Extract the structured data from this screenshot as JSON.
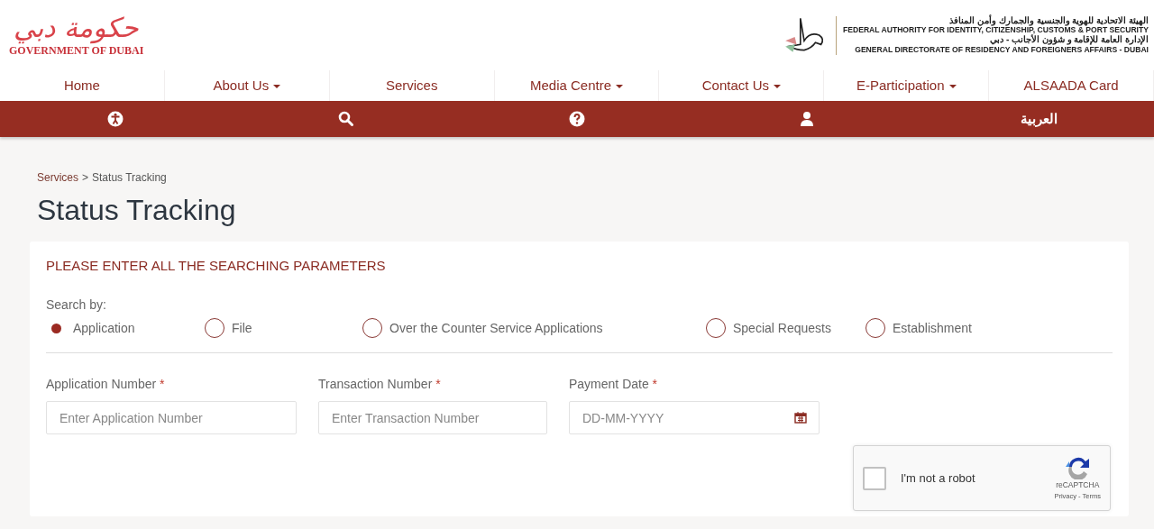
{
  "header": {
    "logo_arabic": "حكومة دبي",
    "logo_english": "GOVERNMENT OF DUBAI",
    "authority_lines": [
      "الهيئة الاتحادية للهوية والجنسية والجمارك وأمن المنافذ",
      "FEDERAL AUTHORITY FOR IDENTITY, CITIZENSHIP, CUSTOMS & PORT SECURITY",
      "الإدارة العامة للإقامة و شؤون الأجانب - دبي",
      "GENERAL DIRECTORATE OF RESIDENCY AND FOREIGNERS AFFAIRS - DUBAI"
    ]
  },
  "nav": [
    {
      "label": "Home",
      "dropdown": false
    },
    {
      "label": "About Us",
      "dropdown": true
    },
    {
      "label": "Services",
      "dropdown": false
    },
    {
      "label": "Media Centre",
      "dropdown": true
    },
    {
      "label": "Contact Us",
      "dropdown": true
    },
    {
      "label": "E-Participation",
      "dropdown": true
    },
    {
      "label": "ALSAADA Card",
      "dropdown": false
    }
  ],
  "toolbar": [
    {
      "kind": "accessibility"
    },
    {
      "kind": "search"
    },
    {
      "kind": "help"
    },
    {
      "kind": "user"
    },
    {
      "kind": "language",
      "label": "العربية"
    }
  ],
  "breadcrumb": [
    {
      "label": "Services"
    },
    {
      "label": "Status Tracking"
    }
  ],
  "breadcrumb_separator": ">",
  "title": "Status Tracking",
  "card_heading": "PLEASE ENTER ALL THE SEARCHING PARAMETERS",
  "search_by": {
    "label": "Search by:",
    "options": [
      {
        "label": "Application",
        "selected": true
      },
      {
        "label": "File",
        "selected": false
      },
      {
        "label": "Over the Counter Service Applications",
        "selected": false
      },
      {
        "label": "Special Requests",
        "selected": false
      },
      {
        "label": "Establishment",
        "selected": false
      }
    ]
  },
  "fields": [
    {
      "label": "Application Number",
      "required": true,
      "kind": "text",
      "placeholder": "Enter Application Number"
    },
    {
      "label": "Transaction Number",
      "required": true,
      "kind": "text",
      "placeholder": "Enter Transaction Number"
    },
    {
      "label": "Payment Date",
      "required": true,
      "kind": "date",
      "placeholder": "DD-MM-YYYY"
    }
  ],
  "required_mark": "*",
  "captcha": {
    "label": "I'm not a robot",
    "checked": false,
    "brand": "reCAPTCHA",
    "links": "Privacy - Terms"
  }
}
